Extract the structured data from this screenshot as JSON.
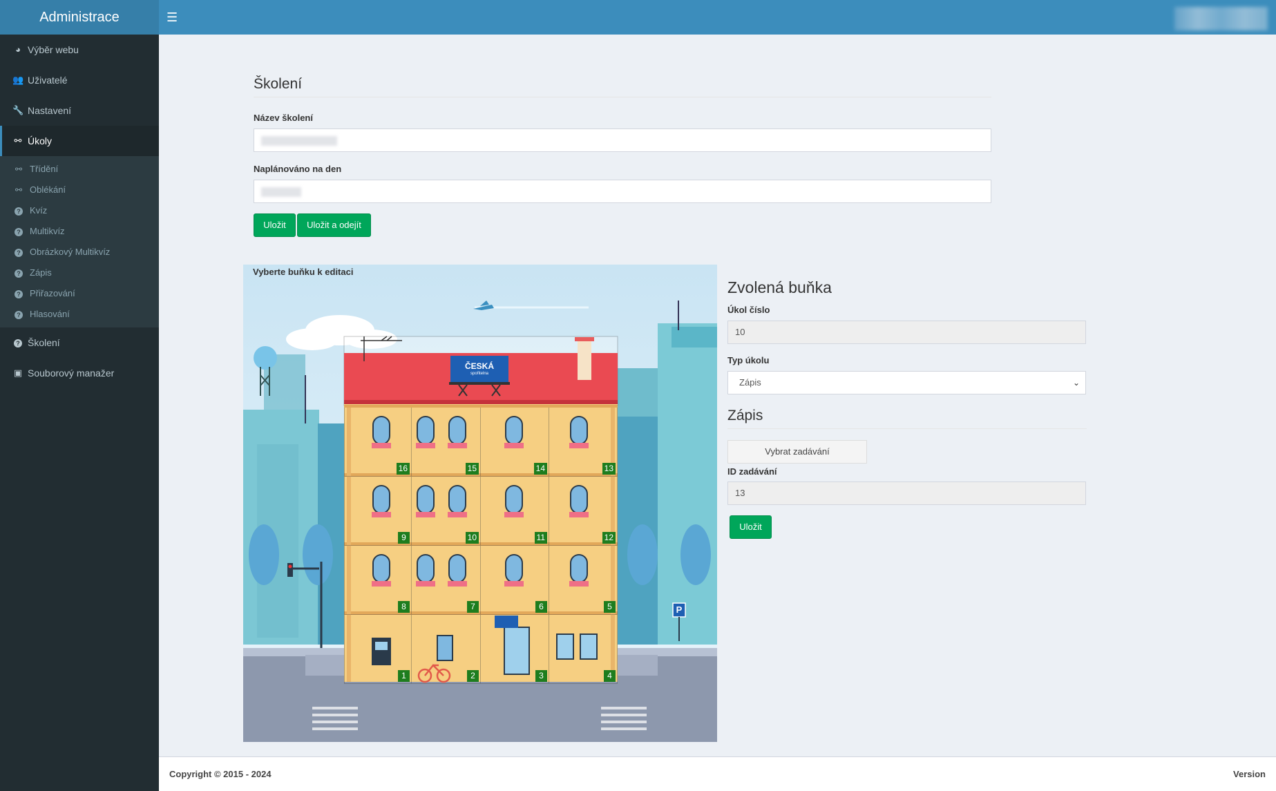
{
  "header": {
    "brand": "Administrace",
    "menu_icon": "bars-icon"
  },
  "sidebar": {
    "items": [
      {
        "label": "Výběr webu",
        "icon": "dashboard-icon"
      },
      {
        "label": "Uživatelé",
        "icon": "users-icon"
      },
      {
        "label": "Nastavení",
        "icon": "wrench-icon"
      },
      {
        "label": "Úkoly",
        "icon": "tasks-icon"
      },
      {
        "label": "Školení",
        "icon": "question-circle-icon"
      },
      {
        "label": "Souborový manažer",
        "icon": "save-icon"
      }
    ],
    "submenu": [
      {
        "label": "Třídění",
        "icon": "tasks-icon"
      },
      {
        "label": "Oblékání",
        "icon": "tasks-icon"
      },
      {
        "label": "Kvíz",
        "icon": "question-circle-icon"
      },
      {
        "label": "Multikvíz",
        "icon": "question-circle-icon"
      },
      {
        "label": "Obrázkový Multikvíz",
        "icon": "question-circle-icon"
      },
      {
        "label": "Zápis",
        "icon": "question-circle-icon"
      },
      {
        "label": "Přiřazování",
        "icon": "question-circle-icon"
      },
      {
        "label": "Hlasování",
        "icon": "question-circle-icon"
      }
    ]
  },
  "form": {
    "title": "Školení",
    "name_label": "Název školení",
    "date_label": "Naplánováno na den",
    "save": "Uložit",
    "save_exit": "Uložit a odejít"
  },
  "scene": {
    "label": "Vyberte buňku k editaci",
    "bank_sign": "ČESKÁ",
    "bank_sub": "spořitelna",
    "parking": "P",
    "cells": [
      "16",
      "15",
      "14",
      "13",
      "9",
      "10",
      "11",
      "12",
      "8",
      "7",
      "6",
      "5",
      "1",
      "2",
      "3",
      "4"
    ]
  },
  "panel": {
    "title": "Zvolená buňka",
    "task_no_label": "Úkol číslo",
    "task_no": "10",
    "task_type_label": "Typ úkolu",
    "task_type": "Zápis",
    "section_title": "Zápis",
    "choose_btn": "Vybrat zadávání",
    "id_label": "ID zadávání",
    "id_value": "13",
    "save": "Uložit"
  },
  "footer": {
    "copyright": "Copyright © 2015 - 2024",
    "version": "Version"
  }
}
